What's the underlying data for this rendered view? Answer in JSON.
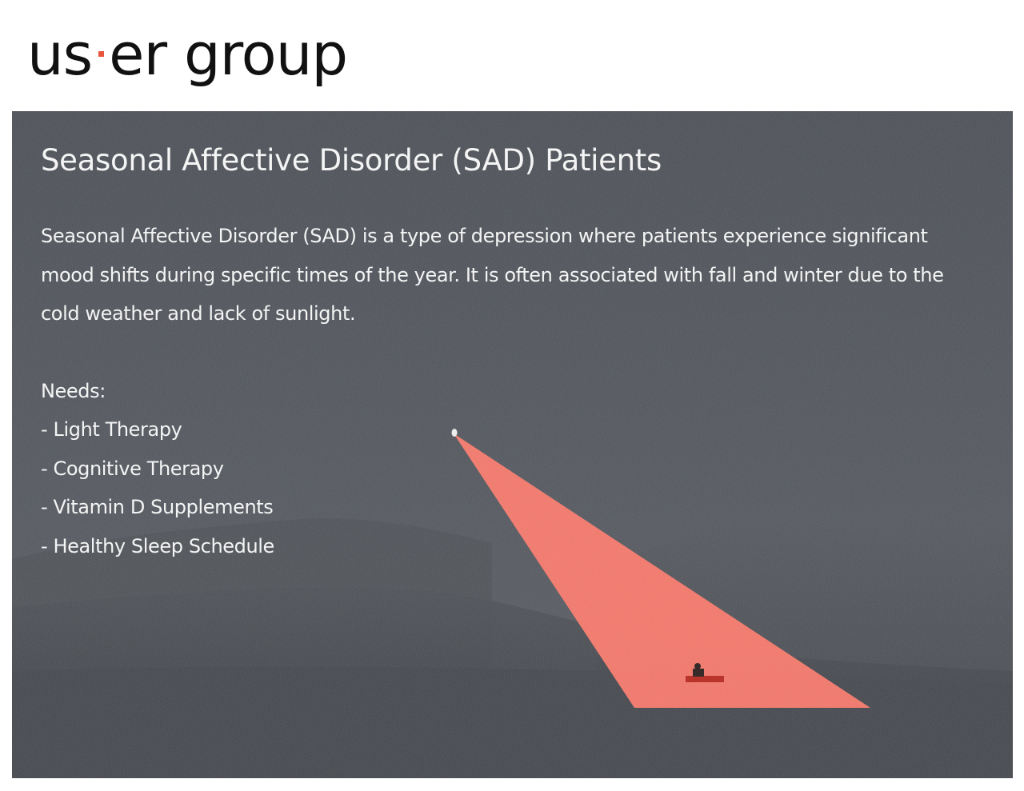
{
  "logo": {
    "part1": "us",
    "part2": "er group",
    "accent_color": "#e8553e"
  },
  "hero": {
    "title": "Seasonal Affective Disorder (SAD) Patients",
    "description": "Seasonal Affective Disorder (SAD) is a type of depression where patients experience significant mood shifts during specific times of the year. It is often associated with fall and winter due to the cold weather and lack of sunlight.",
    "needs_heading": "Needs:",
    "needs": [
      "- Light Therapy",
      "- Cognitive Therapy",
      "- Vitamin D Supplements",
      "- Healthy Sleep Schedule"
    ],
    "light_beam_color": "#ff7a6c"
  }
}
